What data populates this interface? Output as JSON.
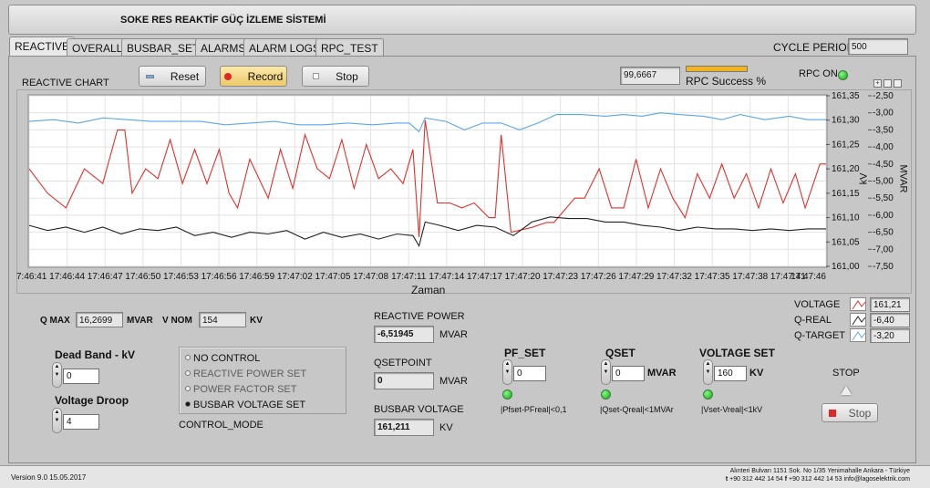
{
  "app": {
    "title": "SOKE RES REAKTİF GÜÇ İZLEME SİSTEMİ"
  },
  "tabs": [
    {
      "label": "REACTIVE",
      "active": true
    },
    {
      "label": "OVERALL"
    },
    {
      "label": "BUSBAR_SET"
    },
    {
      "label": "ALARMS"
    },
    {
      "label": "ALARM LOGS"
    },
    {
      "label": "RPC_TEST"
    }
  ],
  "cycle_period": {
    "label": "CYCLE PERIOD",
    "value": "500"
  },
  "toolbar": {
    "reset_label": "Reset",
    "record_label": "Record",
    "stop_label": "Stop"
  },
  "rpc": {
    "success_value": "99,6667",
    "success_label": "RPC Success %",
    "success_fraction": 0.9967,
    "on_label": "RPC ON",
    "on_state": true
  },
  "chart_data": {
    "type": "line",
    "title": "REACTIVE CHART",
    "xlabel": "Zaman",
    "x_ticks": [
      "7:46:41",
      "17:46:44",
      "17:46:47",
      "17:46:50",
      "17:46:53",
      "17:46:56",
      "17:46:59",
      "17:47:02",
      "17:47:05",
      "17:47:08",
      "17:47:11",
      "17:47:14",
      "17:47:17",
      "17:47:20",
      "17:47:23",
      "17:47:26",
      "17:47:29",
      "17:47:32",
      "17:47:35",
      "17:47:38",
      "17:47:41",
      "17:47:46"
    ],
    "x_range": [
      0,
      65
    ],
    "y_left": {
      "label": "kV",
      "range": [
        161.0,
        161.35
      ],
      "ticks": [
        "161,35",
        "161,30",
        "161,25",
        "161,20",
        "161,15",
        "161,10",
        "161,05",
        "161,00"
      ]
    },
    "y_right": {
      "label": "MVAR",
      "range": [
        -7.5,
        -2.5
      ],
      "ticks": [
        "-2,50",
        "-3,00",
        "-3,50",
        "-4,00",
        "-4,50",
        "-5,00",
        "-5,50",
        "-6,00",
        "-6,50",
        "-7,00",
        "-7,50"
      ]
    },
    "grid": true,
    "series": [
      {
        "name": "VOLTAGE",
        "color": "#e0312c",
        "axis": "left",
        "points": [
          [
            0,
            161.2
          ],
          [
            1.5,
            161.15
          ],
          [
            3,
            161.12
          ],
          [
            4.5,
            161.2
          ],
          [
            6,
            161.17
          ],
          [
            7.2,
            161.28
          ],
          [
            7.8,
            161.28
          ],
          [
            8.4,
            161.15
          ],
          [
            9.5,
            161.2
          ],
          [
            10.5,
            161.18
          ],
          [
            11.5,
            161.26
          ],
          [
            12.5,
            161.17
          ],
          [
            13.5,
            161.24
          ],
          [
            14.5,
            161.17
          ],
          [
            15.5,
            161.24
          ],
          [
            16.3,
            161.15
          ],
          [
            17,
            161.12
          ],
          [
            18,
            161.22
          ],
          [
            19.5,
            161.14
          ],
          [
            20.5,
            161.24
          ],
          [
            21.5,
            161.16
          ],
          [
            22.5,
            161.27
          ],
          [
            23.5,
            161.2
          ],
          [
            24.5,
            161.18
          ],
          [
            25.5,
            161.26
          ],
          [
            26.5,
            161.16
          ],
          [
            27.5,
            161.25
          ],
          [
            28.5,
            161.18
          ],
          [
            29.5,
            161.2
          ],
          [
            30.5,
            161.17
          ],
          [
            31.3,
            161.24
          ],
          [
            31.8,
            161.06
          ],
          [
            32.3,
            161.3
          ],
          [
            33.3,
            161.13
          ],
          [
            34.3,
            161.13
          ],
          [
            35.3,
            161.12
          ],
          [
            36.3,
            161.13
          ],
          [
            37.5,
            161.1
          ],
          [
            38,
            161.1
          ],
          [
            38.5,
            161.27
          ],
          [
            39.3,
            161.07
          ],
          [
            41,
            161.08
          ],
          [
            42.2,
            161.09
          ],
          [
            42.8,
            161.09
          ],
          [
            44.5,
            161.14
          ],
          [
            45.3,
            161.14
          ],
          [
            46.5,
            161.2
          ],
          [
            47.5,
            161.12
          ],
          [
            48.5,
            161.12
          ],
          [
            49.5,
            161.22
          ],
          [
            50.5,
            161.12
          ],
          [
            51.5,
            161.2
          ],
          [
            52.5,
            161.14
          ],
          [
            53.5,
            161.1
          ],
          [
            54.5,
            161.19
          ],
          [
            55.5,
            161.14
          ],
          [
            56.5,
            161.21
          ],
          [
            57.5,
            161.14
          ],
          [
            58.5,
            161.19
          ],
          [
            59.5,
            161.12
          ],
          [
            60.5,
            161.2
          ],
          [
            61.5,
            161.13
          ],
          [
            62.5,
            161.19
          ],
          [
            63.3,
            161.12
          ],
          [
            64.5,
            161.21
          ],
          [
            65,
            161.21
          ]
        ]
      },
      {
        "name": "Q-REAL",
        "color": "#222222",
        "axis": "right",
        "points": [
          [
            0,
            -6.3
          ],
          [
            1.5,
            -6.45
          ],
          [
            3,
            -6.35
          ],
          [
            4.5,
            -6.5
          ],
          [
            6,
            -6.35
          ],
          [
            7.5,
            -6.55
          ],
          [
            9,
            -6.4
          ],
          [
            10.5,
            -6.45
          ],
          [
            12,
            -6.35
          ],
          [
            13.5,
            -6.6
          ],
          [
            15,
            -6.5
          ],
          [
            16.5,
            -6.65
          ],
          [
            18,
            -6.5
          ],
          [
            19.5,
            -6.55
          ],
          [
            21,
            -6.45
          ],
          [
            22.5,
            -6.7
          ],
          [
            24,
            -6.5
          ],
          [
            25.5,
            -6.65
          ],
          [
            27,
            -6.55
          ],
          [
            28.5,
            -6.7
          ],
          [
            30,
            -6.55
          ],
          [
            31.3,
            -6.6
          ],
          [
            31.8,
            -6.9
          ],
          [
            32.3,
            -6.2
          ],
          [
            33.5,
            -6.3
          ],
          [
            35,
            -6.45
          ],
          [
            36.5,
            -6.3
          ],
          [
            38,
            -6.35
          ],
          [
            39.5,
            -6.6
          ],
          [
            41,
            -6.2
          ],
          [
            42.5,
            -6.05
          ],
          [
            44,
            -6.1
          ],
          [
            45.5,
            -6.1
          ],
          [
            47,
            -6.2
          ],
          [
            48.5,
            -6.2
          ],
          [
            50,
            -6.3
          ],
          [
            51.5,
            -6.35
          ],
          [
            53,
            -6.45
          ],
          [
            54.5,
            -6.35
          ],
          [
            56,
            -6.4
          ],
          [
            57.5,
            -6.4
          ],
          [
            59,
            -6.45
          ],
          [
            60.5,
            -6.4
          ],
          [
            62,
            -6.45
          ],
          [
            63.5,
            -6.4
          ],
          [
            65,
            -6.4
          ]
        ]
      },
      {
        "name": "Q-TARGET",
        "color": "#5aa7e8",
        "axis": "right",
        "points": [
          [
            0,
            -3.25
          ],
          [
            2,
            -3.2
          ],
          [
            4,
            -3.3
          ],
          [
            6,
            -3.15
          ],
          [
            8,
            -3.2
          ],
          [
            10,
            -3.25
          ],
          [
            12,
            -3.25
          ],
          [
            14,
            -3.25
          ],
          [
            16,
            -3.35
          ],
          [
            18,
            -3.3
          ],
          [
            20,
            -3.25
          ],
          [
            22,
            -3.35
          ],
          [
            24,
            -3.35
          ],
          [
            26,
            -3.3
          ],
          [
            28,
            -3.35
          ],
          [
            30,
            -3.3
          ],
          [
            31,
            -3.3
          ],
          [
            31.8,
            -3.55
          ],
          [
            32.3,
            -3.15
          ],
          [
            34,
            -3.25
          ],
          [
            35.5,
            -3.5
          ],
          [
            37,
            -3.3
          ],
          [
            38.5,
            -3.3
          ],
          [
            40,
            -3.5
          ],
          [
            41.5,
            -3.3
          ],
          [
            43,
            -3.05
          ],
          [
            45,
            -3.05
          ],
          [
            47,
            -3.1
          ],
          [
            48.5,
            -3.05
          ],
          [
            50,
            -3.1
          ],
          [
            51.5,
            -3.0
          ],
          [
            53,
            -3.05
          ],
          [
            55,
            -3.1
          ],
          [
            56.5,
            -3.2
          ],
          [
            58,
            -3.05
          ],
          [
            60,
            -3.2
          ],
          [
            62,
            -3.1
          ],
          [
            63.5,
            -3.2
          ],
          [
            65,
            -3.2
          ]
        ]
      }
    ],
    "legend": [
      {
        "name": "VOLTAGE",
        "value": "161,21",
        "color": "#e0312c"
      },
      {
        "name": "Q-REAL",
        "value": "-6,40",
        "color": "#222222"
      },
      {
        "name": "Q-TARGET",
        "value": "-3,20",
        "color": "#5aa7e8"
      }
    ]
  },
  "params": {
    "qmax_label": "Q  MAX",
    "qmax_value": "16,2699",
    "qmax_unit": "MVAR",
    "vnom_label": "V  NOM",
    "vnom_value": "154",
    "vnom_unit": "KV"
  },
  "dead_band": {
    "label": "Dead Band - kV",
    "value": "0"
  },
  "voltage_droop": {
    "label": "Voltage Droop",
    "value": "4"
  },
  "control_mode": {
    "label": "CONTROL_MODE",
    "options": [
      {
        "label": "NO CONTROL",
        "selected": false,
        "dim": false
      },
      {
        "label": "REACTIVE POWER SET",
        "selected": false,
        "dim": true
      },
      {
        "label": "POWER FACTOR SET",
        "selected": false,
        "dim": true
      },
      {
        "label": "BUSBAR VOLTAGE SET",
        "selected": true,
        "dim": false
      }
    ]
  },
  "readouts": {
    "reactive_power_label": "REACTIVE POWER",
    "reactive_power_value": "-6,51945",
    "reactive_power_unit": "MVAR",
    "qsetpoint_label": "QSETPOINT",
    "qsetpoint_value": "0",
    "qsetpoint_unit": "MVAR",
    "busbar_voltage_label": "BUSBAR VOLTAGE",
    "busbar_voltage_value": "161,211",
    "busbar_voltage_unit": "KV"
  },
  "setpoints": {
    "pf_label": "PF_SET",
    "pf_value": "0",
    "pf_cond": "|Pfset-PFreal|<0,1",
    "qset_label": "QSET",
    "qset_value": "0",
    "qset_unit": "MVAR",
    "qset_cond": "|Qset-Qreal|<1MVAr",
    "vset_label": "VOLTAGE SET",
    "vset_value": "160",
    "vset_unit": "KV",
    "vset_cond": "|Vset-Vreal|<1kV"
  },
  "stop_panel": {
    "label": "STOP",
    "button_label": "Stop"
  },
  "footer": {
    "version": "Version 9.0 15.05.2017",
    "address": "Alınteri Bulvarı 1151 Sok. No 1/35 Yenimahalle  Ankara - Türkiye",
    "contact_t_prefix": "t",
    "contact_phone": "+90 312 442 14 54",
    "contact_f_prefix": "f",
    "contact_fax": "+90 312 442 14 53",
    "contact_email": "info@lagoselektrik.com"
  }
}
